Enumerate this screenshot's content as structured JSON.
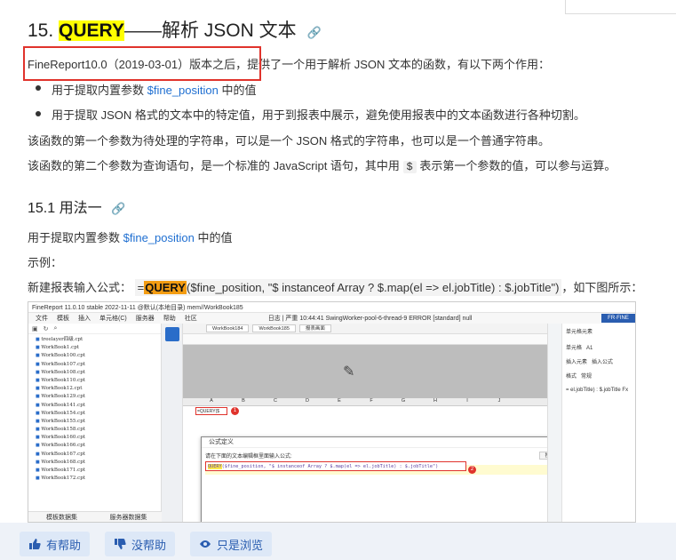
{
  "heading": {
    "number": "15.",
    "keyword": "QUERY",
    "rest": "——解析 JSON 文本",
    "anchor_icon": "link-icon"
  },
  "intro": {
    "version_text": "FineReport10.0（2019-03-01）版本之后，",
    "rest": "提供了一个用于解析 JSON 文本的函数，有以下两个作用："
  },
  "bullets": [
    {
      "prefix": "用于提取内置参数 ",
      "code": "$fine_position",
      "suffix": " 中的值"
    },
    {
      "text": "用于提取 JSON 格式的文本中的特定值，用于到报表中展示，避免使用报表中的文本函数进行各种切割。"
    }
  ],
  "param1_text": "该函数的第一个参数为待处理的字符串，可以是一个 JSON 格式的字符串，也可以是一个普通字符串。",
  "param2": {
    "prefix": "该函数的第二个参数为查询语句，是一个标准的 JavaScript 语句，其中用 ",
    "code": "$",
    "suffix": " 表示第一个参数的值，可以参与运算。"
  },
  "section": {
    "title": "15.1 用法一",
    "anchor_icon": "link-icon"
  },
  "usage": {
    "prefix": "用于提取内置参数 ",
    "code": "$fine_position",
    "suffix": " 中的值"
  },
  "example_label": "示例：",
  "new_report": {
    "prefix": "新建报表输入公式：",
    "eq": "=",
    "func": "QUERY",
    "args": "($fine_position, \"$ instanceof Array ? $.map(el => el.jobTitle) : $.jobTitle\")",
    "suffix": "，如下图所示："
  },
  "screenshot": {
    "titlebar": "FineReport 11.0.10 stable 2022-11-11 @默认(本地目录)   mem//WorkBook185",
    "menu": [
      "文件",
      "模板",
      "插入",
      "单元格(C)",
      "服务器",
      "帮助",
      "社区"
    ],
    "log_text": "日志 | 严重 10:44:41 SwingWorker-pool-6-thread-9 ERROR [standard] null",
    "brand": "FR·FINE",
    "files": [
      "treelayer四级.cpt",
      "WorkBook1.cpt",
      "WorkBook100.cpt",
      "WorkBook107.cpt",
      "WorkBook108.cpt",
      "WorkBook110.cpt",
      "WorkBook12.cpt",
      "WorkBook129.cpt",
      "WorkBook141.cpt",
      "WorkBook154.cpt",
      "WorkBook155.cpt",
      "WorkBook158.cpt",
      "WorkBook160.cpt",
      "WorkBook166.cpt",
      "WorkBook167.cpt",
      "WorkBook168.cpt",
      "WorkBook171.cpt",
      "WorkBook172.cpt"
    ],
    "left_tabs": [
      "模板数据集",
      "服务器数据集"
    ],
    "tabs": [
      "WorkBook184",
      "WorkBook185"
    ],
    "tab_extra": "报表画面",
    "columns": [
      "A",
      "B",
      "C",
      "D",
      "E",
      "F",
      "G",
      "H",
      "I",
      "J"
    ],
    "cell_a1": "=QUERY($",
    "badge1": "1",
    "badge2": "2",
    "dialog_title": "公式定义",
    "dialog_prompt": "请在下面的文本编辑框里面输入公式:",
    "dialog_search": "搜索",
    "dialog_formula_func": "QUERY",
    "dialog_formula_rest": "($fine_position, \"$ instanceof Array ? $.map(el => el.jobTitle) : $.jobTitle\")",
    "right_title": "单元格元素",
    "right_cell_label": "单元格",
    "right_cell_value": "A1",
    "right_insert_label": "插入元素",
    "right_insert_value": "插入公式",
    "right_format_label": "格式",
    "right_format_value": "常规",
    "right_formula_preview": "= el.jobTitle) : $.jobTitle",
    "right_fx": "Fx"
  },
  "footer": {
    "helpful": "有帮助",
    "not_helpful": "没帮助",
    "just_browsing": "只是浏览"
  }
}
